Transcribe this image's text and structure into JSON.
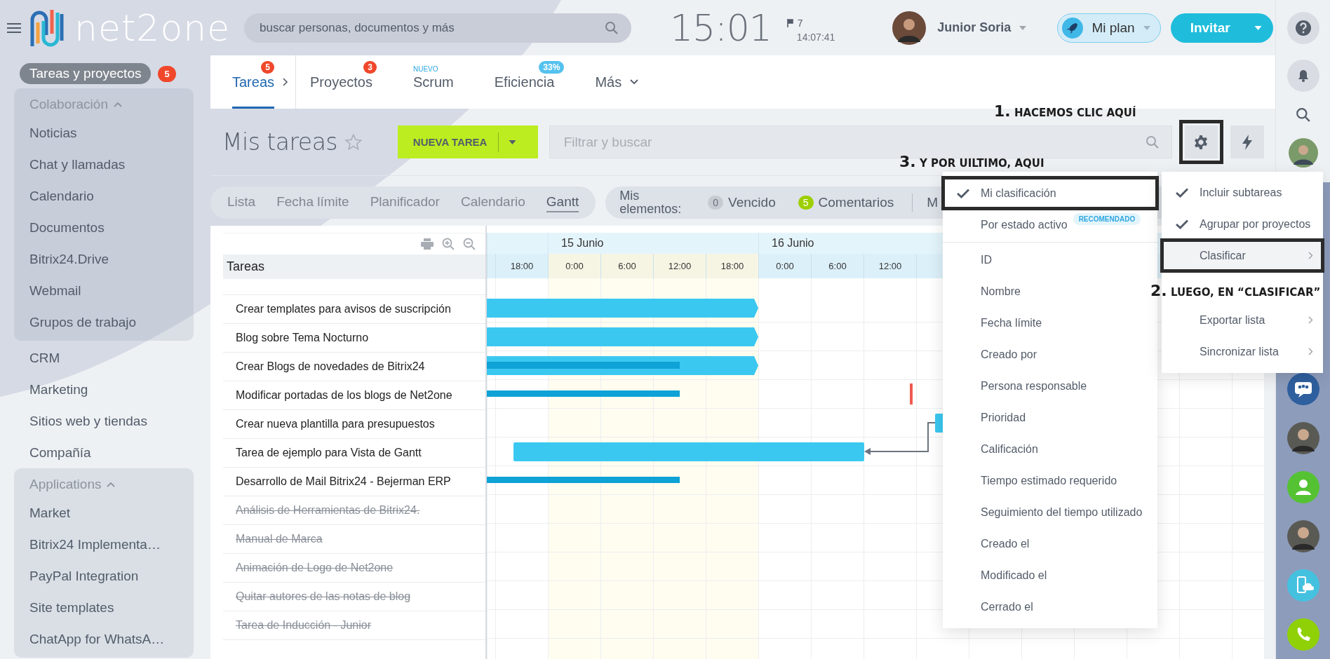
{
  "header": {
    "logo": "net2one",
    "search": {
      "placeholder": "buscar personas, documentos y más"
    },
    "clock": "15:01",
    "flag_count": "7",
    "time": "14:07:41",
    "user": "Junior Soria",
    "plan": "Mi plan",
    "invite": "Invitar"
  },
  "sidebar": {
    "current": {
      "label": "Tareas y proyectos",
      "count": "5"
    },
    "sections": [
      {
        "kind": "group",
        "title": "Colaboración",
        "expanded": true,
        "items": [
          "Noticias",
          "Chat y llamadas",
          "Calendario",
          "Documentos",
          "Bitrix24.Drive",
          "Webmail",
          "Grupos de trabajo"
        ]
      },
      {
        "kind": "link",
        "label": "CRM"
      },
      {
        "kind": "link",
        "label": "Marketing"
      },
      {
        "kind": "link",
        "label": "Sitios web y tiendas"
      },
      {
        "kind": "link",
        "label": "Compañía"
      },
      {
        "kind": "group",
        "title": "Applications",
        "expanded": true,
        "items": [
          "Market",
          "Bitrix24 Implementa…",
          "PayPal Integration",
          "Site templates",
          "ChatApp for WhatsA…"
        ]
      }
    ]
  },
  "tabs": [
    {
      "label": "Tareas",
      "kind": "next",
      "selected": true,
      "badge": {
        "kind": "count",
        "text": "5"
      }
    },
    {
      "label": "Proyectos",
      "kind": "plain",
      "selected": false,
      "badge": {
        "kind": "count",
        "text": "3"
      }
    },
    {
      "label": "Scrum",
      "kind": "plain",
      "selected": false,
      "badge": {
        "kind": "new",
        "text": "NUEVO"
      }
    },
    {
      "label": "Eficiencia",
      "kind": "plain",
      "selected": false,
      "badge": {
        "kind": "percent",
        "text": "33%"
      }
    },
    {
      "label": "Más",
      "kind": "menu",
      "selected": false
    }
  ],
  "page_title": "Mis tareas",
  "starred": false,
  "new_task": "NUEVA TAREA",
  "filter": {
    "placeholder": "Filtrar y buscar"
  },
  "settings_button": {
    "highlighted": true
  },
  "views": [
    {
      "label": "Lista",
      "selected": false
    },
    {
      "label": "Fecha límite",
      "selected": false
    },
    {
      "label": "Planificador",
      "selected": false
    },
    {
      "label": "Calendario",
      "selected": false
    },
    {
      "label": "Gantt",
      "selected": true
    }
  ],
  "counters": {
    "label": "Mis elementos:",
    "items": [
      {
        "count": "0",
        "label": "Vencido",
        "active": false
      },
      {
        "count": "5",
        "label": "Comentarios",
        "active": true
      }
    ],
    "more": "M"
  },
  "gantt": {
    "column_title": "Tareas",
    "dates": [
      "15 Junio",
      "16 Junio"
    ],
    "hours": [
      {
        "label": "18:00",
        "shaded": false
      },
      {
        "label": "0:00",
        "shaded": true
      },
      {
        "label": "6:00",
        "shaded": true
      },
      {
        "label": "12:00",
        "shaded": true
      },
      {
        "label": "18:00",
        "shaded": true
      },
      {
        "label": "0:00",
        "shaded": false
      },
      {
        "label": "6:00",
        "shaded": false
      },
      {
        "label": "12:00",
        "shaded": false
      }
    ],
    "tasks": [
      {
        "name": "Crear templates para avisos de suscripción",
        "done": false
      },
      {
        "name": "Blog sobre Tema Nocturno",
        "done": false
      },
      {
        "name": "Crear Blogs de novedades de Bitrix24",
        "done": false,
        "level": 0.71
      },
      {
        "name": "Modificar portadas de los blogs de Net2one",
        "done": false
      },
      {
        "name": "Crear nueva plantilla para presupuestos",
        "done": false
      },
      {
        "name": "Tarea de ejemplo para Vista de Gantt",
        "done": false
      },
      {
        "name": "Desarrollo de Mail Bitrix24 - Bejerman ERP",
        "done": false
      },
      {
        "name": "Análisis de Herramientas de Bitrix24.",
        "done": true
      },
      {
        "name": "Manual de Marca",
        "done": true
      },
      {
        "name": "Animación de Logo de Net2one",
        "done": true
      },
      {
        "name": "Quitar autores de las notas de blog",
        "done": true
      },
      {
        "name": "Tarea de Inducción - Junior",
        "done": true
      }
    ]
  },
  "sort_menu": {
    "groups": [
      [
        {
          "label": "Mi clasificación",
          "checked": true,
          "highlighted": true
        },
        {
          "label": "Por estado activo",
          "checked": false,
          "highlighted": false,
          "badge": "RECOMENDADO"
        }
      ],
      [
        {
          "label": "ID",
          "checked": false,
          "highlighted": false
        },
        {
          "label": "Nombre",
          "checked": false,
          "highlighted": false
        },
        {
          "label": "Fecha límite",
          "checked": false,
          "highlighted": false
        },
        {
          "label": "Creado por",
          "checked": false,
          "highlighted": false
        },
        {
          "label": "Persona responsable",
          "checked": false,
          "highlighted": false
        },
        {
          "label": "Prioridad",
          "checked": false,
          "highlighted": false
        },
        {
          "label": "Calificación",
          "checked": false,
          "highlighted": false
        },
        {
          "label": "Tiempo estimado requerido",
          "checked": false,
          "highlighted": false
        },
        {
          "label": "Seguimiento del tiempo utilizado",
          "checked": false,
          "highlighted": false
        },
        {
          "label": "Creado el",
          "checked": false,
          "highlighted": false
        },
        {
          "label": "Modificado el",
          "checked": false,
          "highlighted": false
        },
        {
          "label": "Cerrado el",
          "checked": false,
          "highlighted": false
        }
      ]
    ]
  },
  "settings_menu": {
    "items": [
      {
        "label": "Incluir subtareas",
        "checked": true,
        "submenu": false,
        "open": false,
        "highlighted": false
      },
      {
        "label": "Agrupar por proyectos",
        "checked": true,
        "submenu": false,
        "open": false,
        "highlighted": false
      },
      {
        "label": "Clasificar",
        "checked": false,
        "submenu": true,
        "open": true,
        "highlighted": true
      },
      {
        "label": "Exportar lista",
        "checked": false,
        "submenu": true,
        "open": false,
        "highlighted": false
      },
      {
        "label": "Sincronizar lista",
        "checked": false,
        "submenu": true,
        "open": false,
        "highlighted": false
      }
    ]
  },
  "annotations": [
    {
      "number": "1.",
      "text": "HACEMOS CLIC AQUÍ"
    },
    {
      "number": "3.",
      "text": "Y POR UILTIMO, AQUI"
    },
    {
      "number": "2.",
      "text": "LUEGO, EN “CLASIFICAR”"
    }
  ]
}
